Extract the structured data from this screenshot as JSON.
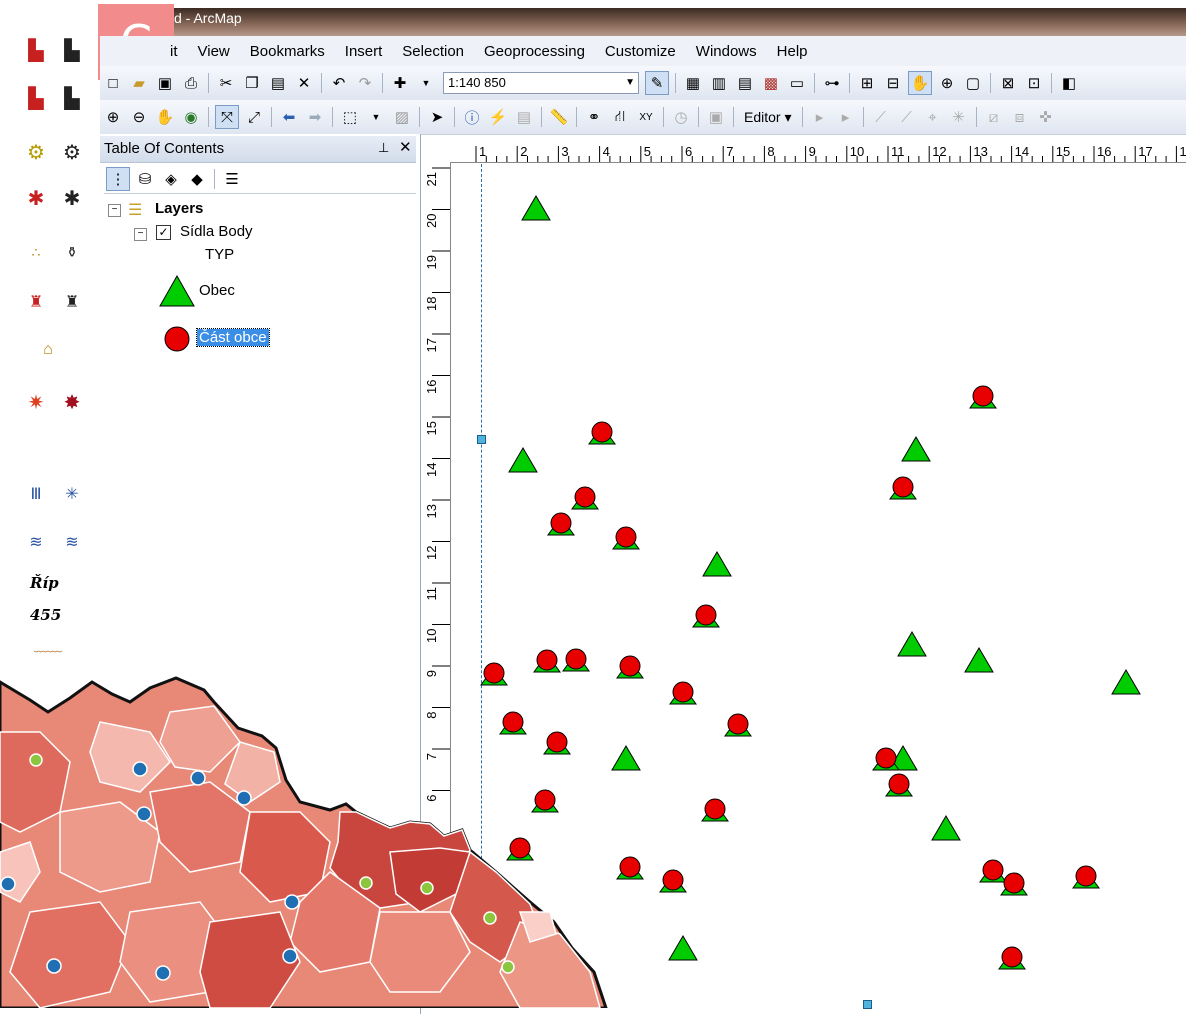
{
  "panel_label": "C",
  "window": {
    "title": "d - ArcMap"
  },
  "menubar": {
    "items": [
      "it",
      "View",
      "Bookmarks",
      "Insert",
      "Selection",
      "Geoprocessing",
      "Customize",
      "Windows",
      "Help"
    ]
  },
  "toolbar": {
    "scale_value": "1:140 850",
    "editor_label": "Editor"
  },
  "toc": {
    "title": "Table Of Contents",
    "pin": "ᵖ",
    "close": "✕",
    "root_label": "Layers",
    "layer_label": "Sídla Body",
    "field_label": "TYP",
    "legend": [
      {
        "label": "Obec",
        "symbol": "triangle",
        "color": "#00cc00"
      },
      {
        "label": "Část obce",
        "symbol": "circle",
        "color": "#e80000"
      }
    ]
  },
  "ruler": {
    "top_ticks": [
      "1",
      "2",
      "3",
      "4",
      "5",
      "6",
      "7",
      "8",
      "9",
      "10",
      "11",
      "12",
      "13",
      "14",
      "15",
      "16",
      "17",
      "1"
    ],
    "left_ticks": [
      "21",
      "20",
      "19",
      "18",
      "17",
      "16",
      "15",
      "14",
      "13",
      "12",
      "11",
      "10",
      "9",
      "8",
      "7",
      "6"
    ]
  },
  "map": {
    "triangle_color": "#00cc00",
    "circle_color": "#e80000"
  },
  "symbol_strip": {
    "rip_label": "Říp",
    "elevation": "455"
  },
  "colors": {
    "choropleth_dark": "#c8463e",
    "choropleth_mid": "#e57a6c",
    "choropleth_light": "#f3a99d",
    "dot_blue": "#1f6fb2",
    "dot_green": "#8cc63e"
  }
}
